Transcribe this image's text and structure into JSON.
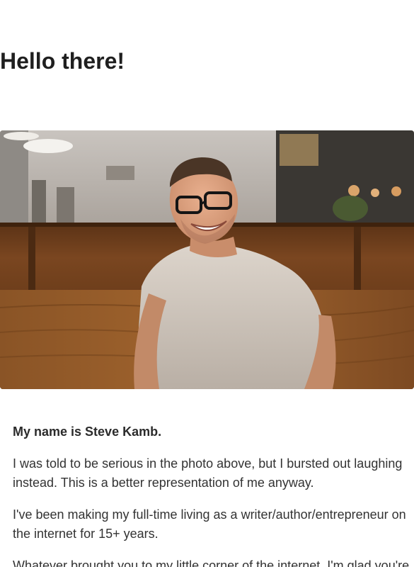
{
  "page": {
    "heading": "Hello there!"
  },
  "photo": {
    "alt_subject": "smiling man with glasses in a cafe booth"
  },
  "content": {
    "intro_name": "My name is Steve Kamb.",
    "paragraph_1": "I was told to be serious in the photo above, but I bursted out laughing instead. This is a better representation of me anyway.",
    "paragraph_2": "I've been making my full-time living as a writer/author/entrepreneur on the internet for 15+ years.",
    "paragraph_3": "Whatever brought you to my little corner of the internet, I'm glad you're"
  },
  "colors": {
    "heading": "#1f1f1f",
    "body_text": "#333333",
    "wood": "#7a4620",
    "shirt": "#cfc6bd"
  }
}
